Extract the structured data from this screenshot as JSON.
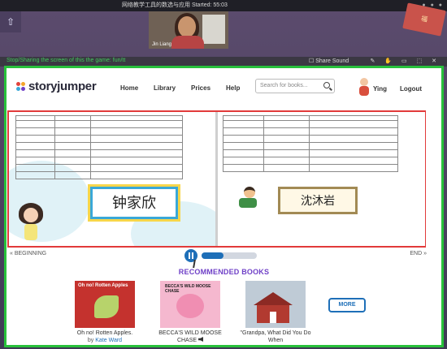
{
  "zoom": {
    "title": "网络教学工具的数选与应用 Started: 55:03",
    "video_name": "Jin Liang"
  },
  "share": {
    "message": "Stop/Sharing the screen of this the game: fun/tt",
    "share_sound": "Share Sound"
  },
  "storyjumper": {
    "logo_text": "storyjumper",
    "nav": [
      "Home",
      "Library",
      "Prices",
      "Help"
    ],
    "search_placeholder": "Search for books...",
    "user_name": "Ying",
    "logout": "Logout"
  },
  "book": {
    "left_name": "钟家欣",
    "right_name": "沈沐岩"
  },
  "pager": {
    "beginning": "« BEGINNING",
    "end": "END »",
    "progress": 0.4
  },
  "recommended": {
    "title": "RECOMMENDED BOOKS",
    "books": [
      {
        "cover_text": "Oh no! Rotten Apples",
        "title": "Oh no! Rotten Apples.",
        "by_prefix": "by",
        "author": "Kate Ward"
      },
      {
        "cover_text": "BECCA'S WILD MOOSE CHASE",
        "title": "BECCA'S WILD MOOSE CHASE",
        "by_prefix": "",
        "author": ""
      },
      {
        "cover_text": "",
        "title": "\"Grandpa, What Did You Do When",
        "by_prefix": "",
        "author": ""
      }
    ],
    "more_label": "MORE"
  },
  "colors": {
    "share_border": "#28c13b",
    "book_border": "#e23a3a",
    "accent_blue": "#1e6fb8",
    "recommended_purple": "#6f40c7"
  }
}
